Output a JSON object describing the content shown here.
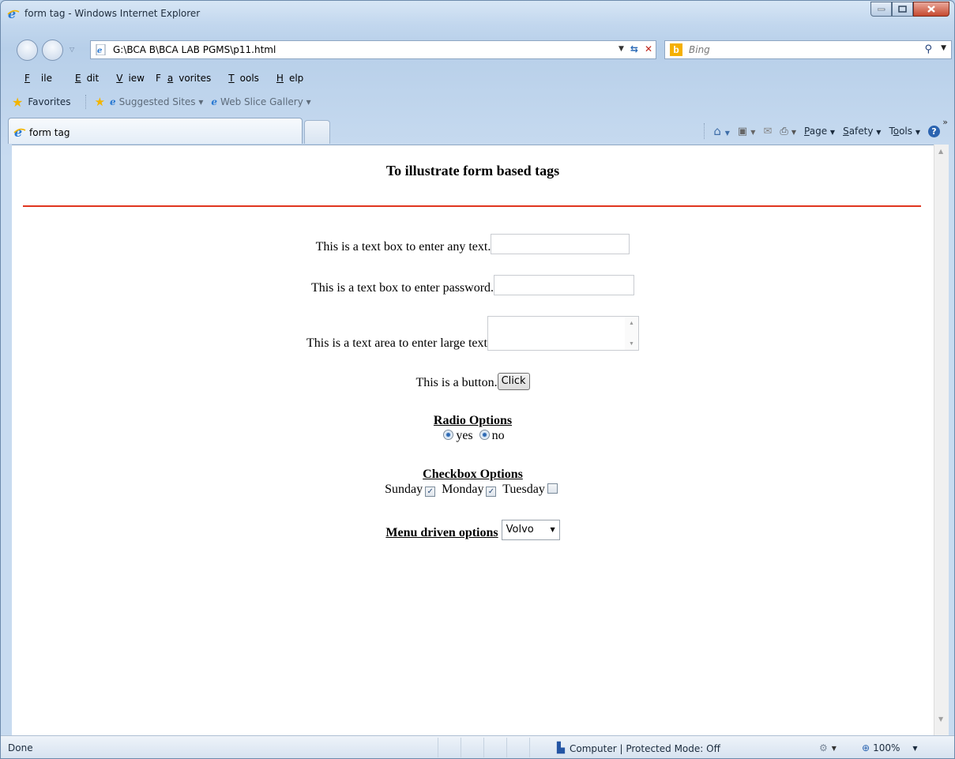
{
  "window": {
    "title": "form tag - Windows Internet Explorer"
  },
  "address_bar": {
    "url": "G:\\BCA B\\BCA LAB PGMS\\p11.html"
  },
  "search": {
    "placeholder": "Bing"
  },
  "menu": {
    "file": "File",
    "edit": "Edit",
    "view": "View",
    "favorites": "Favorites",
    "tools": "Tools",
    "help": "Help"
  },
  "favorites_bar": {
    "label": "Favorites",
    "items": [
      "Suggested Sites ▾",
      "Web Slice Gallery ▾"
    ]
  },
  "tab": {
    "title": "form tag"
  },
  "command_bar": {
    "page": "Page",
    "safety": "Safety",
    "tools": "Tools"
  },
  "page": {
    "heading": "To illustrate form based tags",
    "text_label": "This is a text box to enter any text.",
    "password_label": "This is a text box to enter password.",
    "textarea_label": "This is a text area to enter large text",
    "button_label": "This is a button.",
    "button_text": "Click",
    "radio_title": "Radio Options",
    "radio_options": [
      "yes",
      "no"
    ],
    "checkbox_title": "Checkbox Options",
    "checkboxes": [
      {
        "label": "Sunday",
        "checked": true
      },
      {
        "label": "Monday",
        "checked": true
      },
      {
        "label": "Tuesday",
        "checked": false
      }
    ],
    "menu_title": "Menu driven options",
    "menu_selected": "Volvo"
  },
  "status": {
    "left": "Done",
    "zone": "Computer | Protected Mode: Off",
    "zoom": "100%"
  },
  "colors": {
    "rule": "#e0351f",
    "chrome": "#b9d1ea"
  }
}
